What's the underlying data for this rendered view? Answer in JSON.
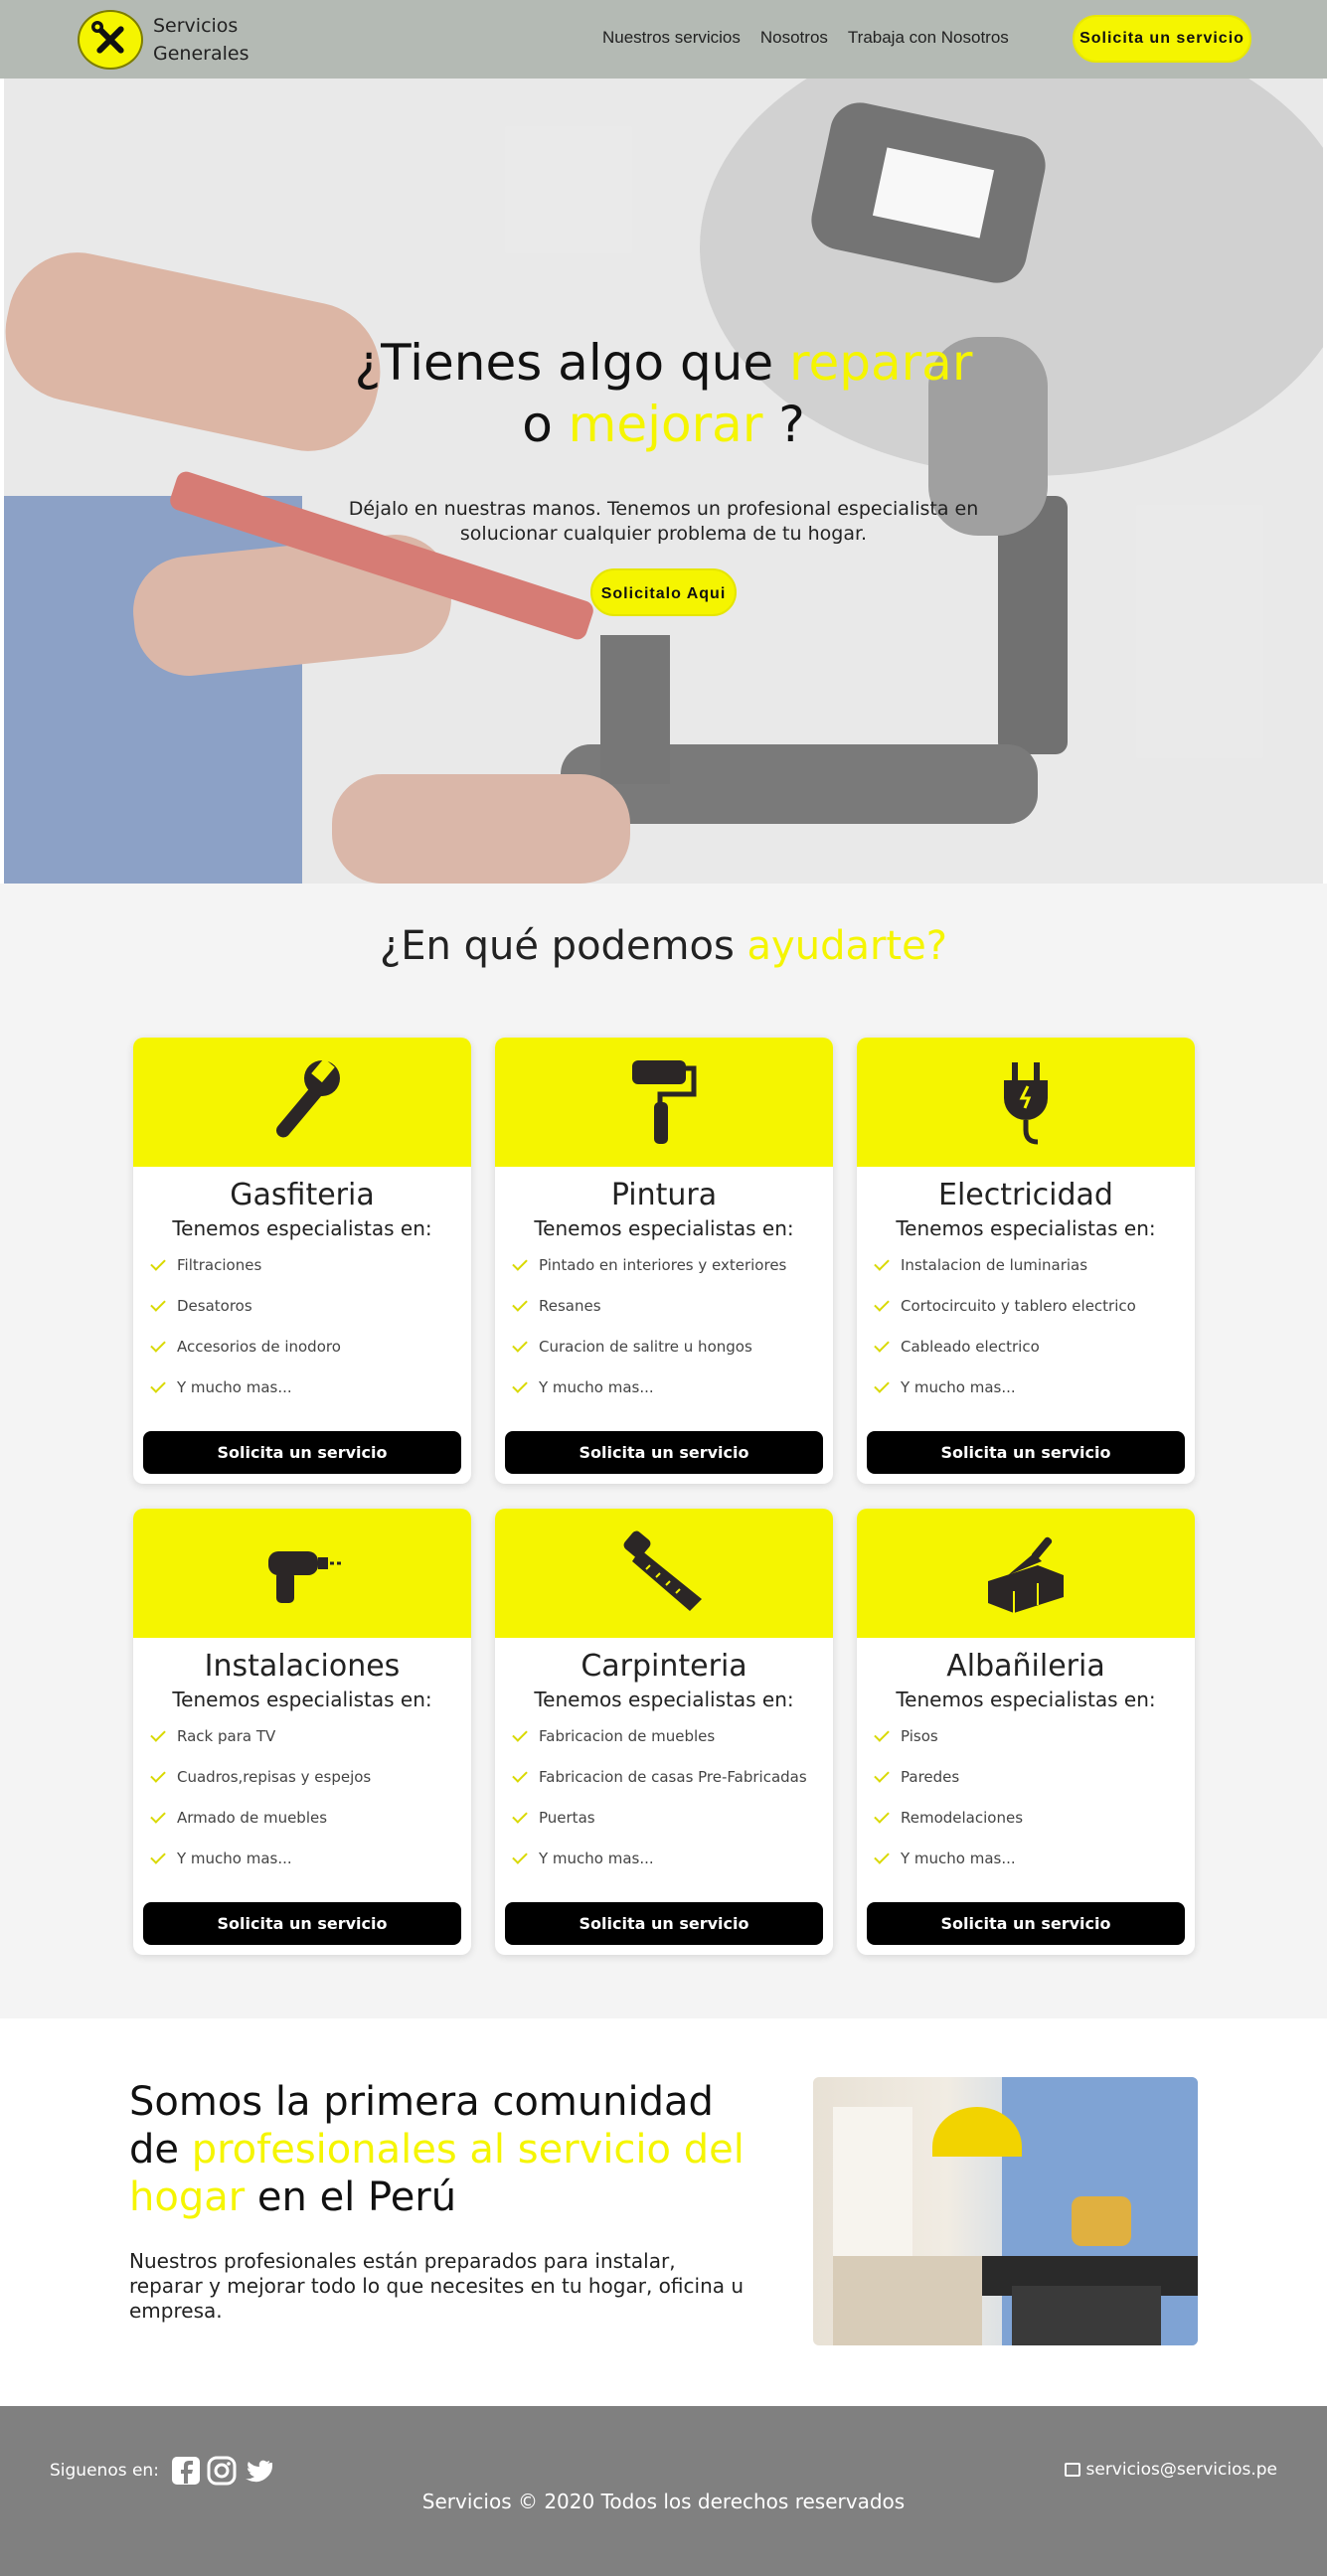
{
  "nav": {
    "brand_line1": "Servicios",
    "brand_line2": "Generales",
    "logo_icon": "tools-icon",
    "links": [
      "Nuestros servicios",
      "Nosotros",
      "Trabaja con Nosotros"
    ],
    "cta": "Solicita un servicio"
  },
  "hero": {
    "title_a": "¿Tienes algo que ",
    "title_hl1": "reparar",
    "title_b": "o ",
    "title_hl2": "mejorar",
    "title_c": " ?",
    "subtitle": "Déjalo en nuestras manos. Tenemos un profesional especialista en solucionar cualquier problema de tu hogar.",
    "cta": "Solicitalo Aqui"
  },
  "services": {
    "title_a": "¿En qué podemos ",
    "title_hl": "ayudarte?",
    "cards": [
      {
        "icon": "wrench-icon",
        "title": "Gasfiteria",
        "subtitle": "Tenemos especialistas en:",
        "items": [
          "Filtraciones",
          "Desatoros",
          "Accesorios de inodoro",
          "Y mucho mas..."
        ],
        "button": "Solicita un servicio"
      },
      {
        "icon": "paint-roller-icon",
        "title": "Pintura",
        "subtitle": "Tenemos especialistas en:",
        "items": [
          "Pintado en interiores y exteriores",
          "Resanes",
          "Curacion de salitre u hongos",
          "Y mucho mas..."
        ],
        "button": "Solicita un servicio"
      },
      {
        "icon": "plug-icon",
        "title": "Electricidad",
        "subtitle": "Tenemos especialistas en:",
        "items": [
          "Instalacion de luminarias",
          "Cortocircuito y tablero electrico",
          "Cableado electrico",
          "Y mucho mas..."
        ],
        "button": "Solicita un servicio"
      },
      {
        "icon": "drill-icon",
        "title": "Instalaciones",
        "subtitle": "Tenemos especialistas en:",
        "items": [
          "Rack para TV",
          "Cuadros,repisas y espejos",
          "Armado de muebles",
          "Y mucho mas..."
        ],
        "button": "Solicita un servicio"
      },
      {
        "icon": "saw-icon",
        "title": "Carpinteria",
        "subtitle": "Tenemos especialistas en:",
        "items": [
          "Fabricacion de muebles",
          "Fabricacion de casas Pre-Fabricadas",
          "Puertas",
          "Y mucho mas..."
        ],
        "button": "Solicita un servicio"
      },
      {
        "icon": "trowel-brick-icon",
        "title": "Albañileria",
        "subtitle": "Tenemos especialistas en:",
        "items": [
          "Pisos",
          "Paredes",
          "Remodelaciones",
          "Y mucho mas..."
        ],
        "button": "Solicita un servicio"
      }
    ]
  },
  "about": {
    "title_a": "Somos la primera comunidad de ",
    "title_hl": "profesionales al servicio del hogar",
    "title_b": " en el Perú",
    "text": "Nuestros profesionales están preparados para instalar, reparar y mejorar todo lo que necesites en tu hogar, oficina u empresa."
  },
  "footer": {
    "follow": "Siguenos en:",
    "social": [
      "facebook-icon",
      "instagram-icon",
      "twitter-icon"
    ],
    "email": "servicios@servicios.pe",
    "copyright": "Servicios © 2020 Todos los derechos reservados"
  },
  "colors": {
    "accent": "#f5f500",
    "nav_bg": "#b4bab4",
    "footer_bg": "#808080",
    "section_bg": "#f4f4f4"
  }
}
